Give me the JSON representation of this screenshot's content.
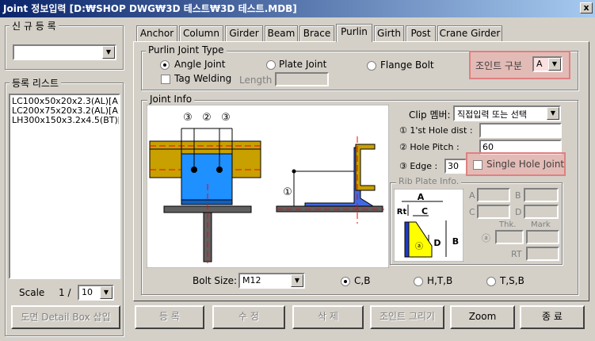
{
  "window": {
    "title": "Joint 정보입력  [D:₩SHOP DWG₩3D 테스트₩3D 테스트.MDB]",
    "close": "x"
  },
  "left": {
    "new_reg_label": "신 규 등 록",
    "new_reg_value": "",
    "list_label": "등록 리스트",
    "list_items": [
      "LC100x50x20x2.3(AL)[A,",
      "LC200x75x20x3.2(AL)[A,",
      "LH300x150x3.2x4.5(BT)["
    ],
    "scale_label": "Scale",
    "scale_prefix": "1 /",
    "scale_value": "10",
    "detail_box_button": "도면 Detail Box 삽입"
  },
  "tabs": [
    {
      "label": "Anchor"
    },
    {
      "label": "Column"
    },
    {
      "label": "Girder"
    },
    {
      "label": "Beam"
    },
    {
      "label": "Brace"
    },
    {
      "label": "Purlin"
    },
    {
      "label": "Girth"
    },
    {
      "label": "Post"
    },
    {
      "label": "Crane Girder"
    }
  ],
  "purlin_type": {
    "label": "Purlin Joint Type",
    "angle": "Angle Joint",
    "plate": "Plate Joint",
    "flange": "Flange Bolt",
    "tag_welding": "Tag Welding",
    "length_label": "Length",
    "length_value": "",
    "joint_class_label": "조인트 구분",
    "joint_class_value": "A"
  },
  "joint_info": {
    "label": "Joint Info",
    "clip_label": "Clip 멤버:",
    "clip_value": "직접입력 또는 선택",
    "hole1_label": "① 1'st Hole dist :",
    "hole1_value": "",
    "pitch_label": "② Hole Pitch :",
    "pitch_value": "60",
    "edge_label": "③ Edge :",
    "edge_value": "30",
    "single_hole": "Single Hole Joint",
    "rib_label": "Rib Plate Info.",
    "rib_fields": {
      "a": "A",
      "b": "B",
      "c": "C",
      "d": "D",
      "thk": "Thk.",
      "mark": "Mark",
      "rt": "RT",
      "circ_a": "ⓐ"
    },
    "bolt_size_label": "Bolt Size:",
    "bolt_size_value": "M12",
    "cb": "C,B",
    "htb": "H,T,B",
    "tsb": "T,S,B"
  },
  "diagram": {
    "n1": "③",
    "n2": "②",
    "n3": "③",
    "circle1": "①",
    "rib_A": "A",
    "rib_B": "B",
    "rib_C": "C",
    "rib_D": "D",
    "rib_Rt": "Rt",
    "rib_a": "ⓐ",
    "colors": {
      "beam": "#c8a000",
      "plate": "#1e90ff",
      "clip": "#4169e1",
      "rib": "#ffff00",
      "centerline": "#ff0000",
      "angle": "#606060"
    }
  },
  "bottom": {
    "register": "등 록",
    "modify": "수 정",
    "delete": "삭 제",
    "draw_joint": "조인트 그리기",
    "zoom": "Zoom",
    "exit": "종 료"
  }
}
